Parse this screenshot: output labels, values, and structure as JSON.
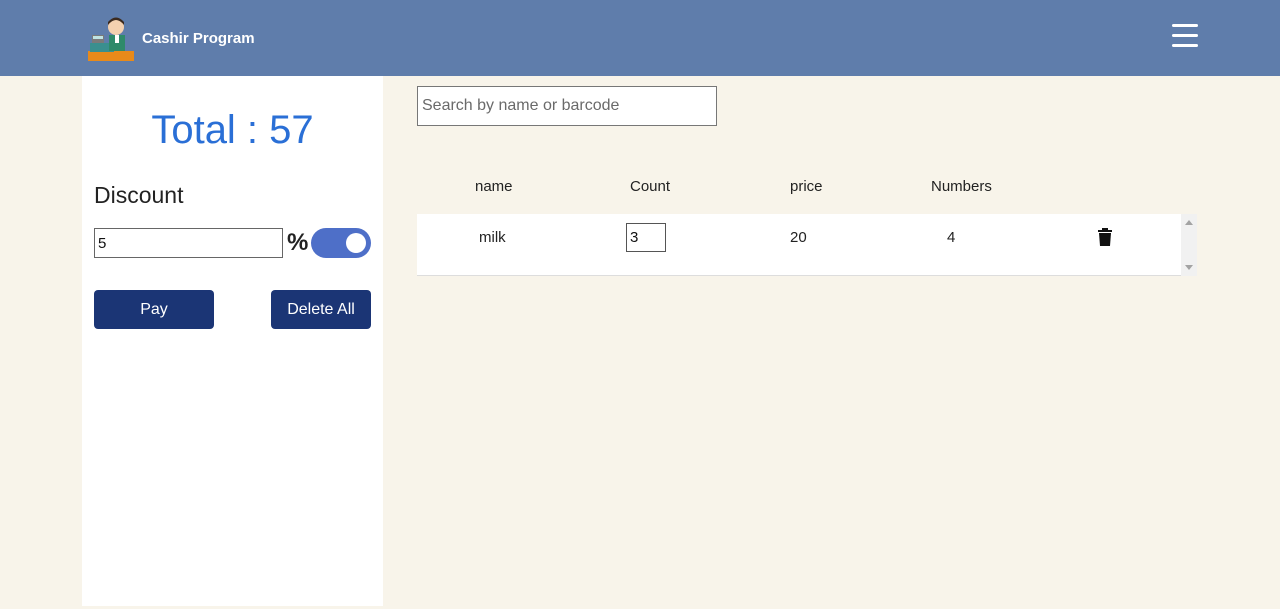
{
  "header": {
    "brand_name": "Cashir Program",
    "logo_icon": "cashier-logo-icon",
    "menu_icon": "hamburger-menu-icon",
    "background_color": "#5f7dab"
  },
  "sidebar": {
    "total_text": "Total : 57",
    "discount_label": "Discount",
    "discount_value": "5",
    "percent_symbol": "%",
    "discount_toggle_on": true,
    "pay_label": "Pay",
    "delete_all_label": "Delete All",
    "button_color": "#1b3575",
    "total_color": "#2a6fd6"
  },
  "search": {
    "placeholder": "Search by name or barcode",
    "value": ""
  },
  "table": {
    "headers": [
      "name",
      "Count",
      "price",
      "Numbers"
    ],
    "rows": [
      {
        "name": "milk",
        "count": "3",
        "price": "20",
        "numbers": "4",
        "delete_icon": "trash-icon"
      }
    ]
  }
}
